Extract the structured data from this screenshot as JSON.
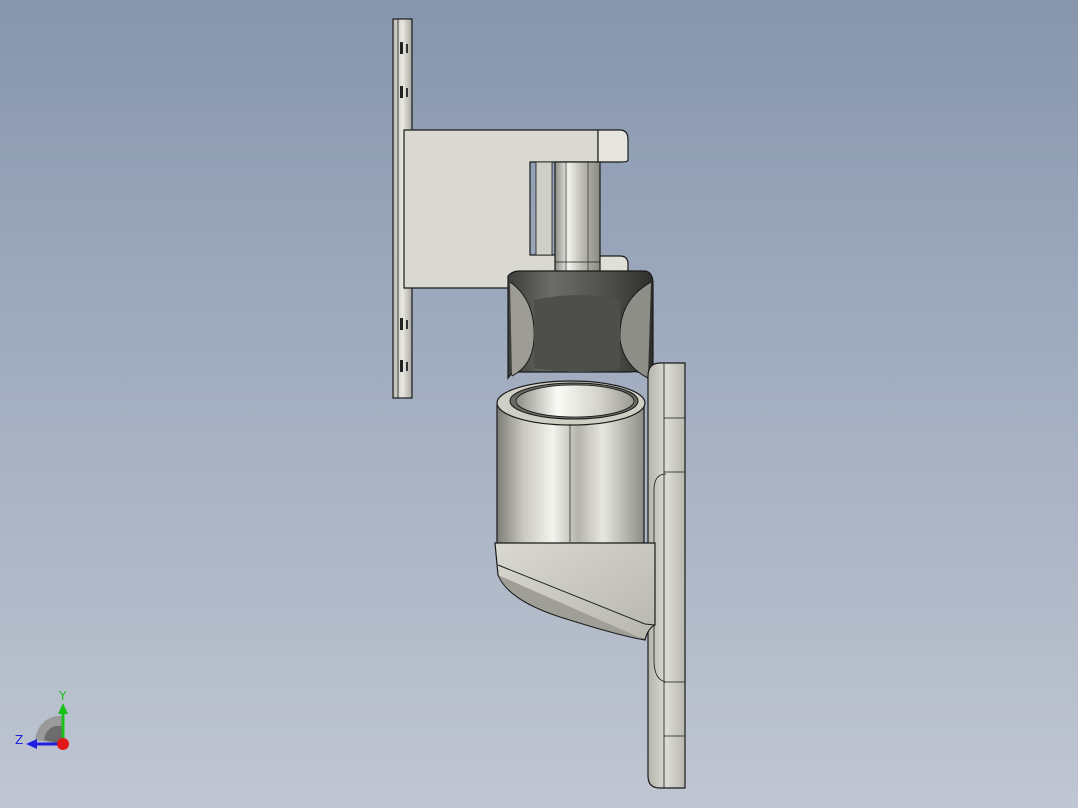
{
  "view": {
    "orientation_triad": {
      "y_label": "Y",
      "z_label": "Z",
      "colors": {
        "y": "#19c219",
        "z": "#1f1fe0",
        "x": "#e01818"
      }
    },
    "model_name": "",
    "colors": {
      "background_top": "#8796ad",
      "background_bottom": "#c0c6d2",
      "part_light": "#e4e4dc",
      "part_mid": "#bdbdb4",
      "part_dark": "#5a5a58",
      "edge": "#1a1a1a"
    }
  }
}
